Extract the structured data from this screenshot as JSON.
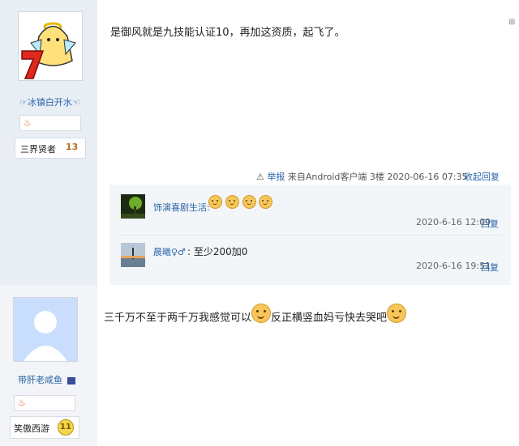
{
  "post1": {
    "username": "☞冰镇白开水☜",
    "level_title": "三界贤者",
    "level_num": "13",
    "content": "是御风就是九技能认证10，再加这资质，起飞了。",
    "report_label": "举报",
    "source": "来自Android客户端",
    "floor": "3楼",
    "datetime": "2020-06-16 07:35",
    "collapse_label": "收起回复",
    "comments": [
      {
        "name": "饰演喜剧生活:",
        "text": "",
        "emoji_count": 4,
        "time": "2020-6-16 12:09",
        "reply": "回复"
      },
      {
        "name": "晨曦♀♂",
        "text": ": 至少200加0",
        "emoji_count": 0,
        "time": "2020-6-16 19:51",
        "reply": "回复"
      }
    ]
  },
  "post2": {
    "username": "带肝老咸鱼",
    "level_title": "笑傲西游",
    "level_num": "11",
    "content_part1": "三千万不至于两千万我感觉可以",
    "content_part2": "反正横竖血妈亏快去哭吧"
  },
  "colors": {
    "link": "#2b64a8",
    "sidebar": "#e9eef5",
    "comment_bg": "#f3f6f9"
  }
}
